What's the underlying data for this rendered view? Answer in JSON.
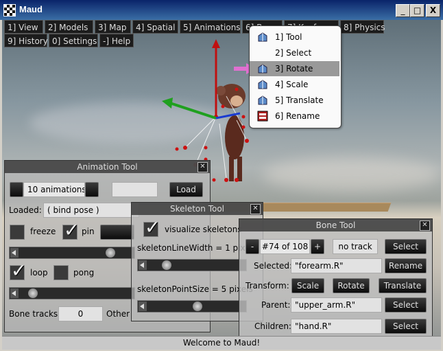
{
  "window": {
    "title": "Maud",
    "minimize": "_",
    "maximize": "□",
    "close": "X"
  },
  "menubar": {
    "row1": [
      "1] View",
      "2] Models",
      "3] Map",
      "4] Spatial",
      "5] Animations",
      "6] Bone",
      "7] Keyframe",
      "8] Physics"
    ],
    "row2": [
      "9] History",
      "0] Settings",
      "-] Help"
    ]
  },
  "dropdown": {
    "items": [
      {
        "label": "1] Tool",
        "icon": "tool-icon"
      },
      {
        "label": "2] Select",
        "icon": ""
      },
      {
        "label": "3] Rotate",
        "icon": "rotate-icon",
        "selected": true
      },
      {
        "label": "4] Scale",
        "icon": "scale-icon"
      },
      {
        "label": "5] Translate",
        "icon": "translate-icon"
      },
      {
        "label": "6] Rename",
        "icon": "rename-icon"
      }
    ]
  },
  "animation_tool": {
    "title": "Animation Tool",
    "count_label": "10 animations",
    "load_button": "Load",
    "loaded_label": "Loaded:",
    "loaded_value": "( bind pose )",
    "freeze_label": "freeze",
    "pin_label": "pin",
    "freeze_checked": false,
    "pin_checked": true,
    "loop_label": "loop",
    "pong_label": "pong",
    "loop_checked": true,
    "pong_checked": false,
    "bone_tracks_label": "Bone tracks:",
    "bone_tracks_value": "0",
    "other_label": "Other"
  },
  "skeleton_tool": {
    "title": "Skeleton Tool",
    "visualize_label": "visualize skeletons",
    "visualize_checked": true,
    "line_width_label": "skeletonLineWidth = 1 pixel",
    "point_size_label": "skeletonPointSize = 5 pixels"
  },
  "bone_tool": {
    "title": "Bone Tool",
    "prev_button": "-",
    "index_label": "#74 of 108",
    "next_button": "+",
    "track_label": "no track",
    "select_button": "Select",
    "selected_label": "Selected:",
    "selected_value": "\"forearm.R\"",
    "rename_button": "Rename",
    "transform_label": "Transform:",
    "scale_button": "Scale",
    "rotate_button": "Rotate",
    "translate_button": "Translate",
    "parent_label": "Parent:",
    "parent_value": "\"upper_arm.R\"",
    "parent_select": "Select",
    "children_label": "Children:",
    "children_value": "\"hand.R\"",
    "children_select": "Select"
  },
  "status": {
    "message": "Welcome to Maud!"
  },
  "colors": {
    "axis_x": "#1fa01f",
    "axis_y": "#c01010",
    "pointer_arrow": "#e070d0"
  }
}
